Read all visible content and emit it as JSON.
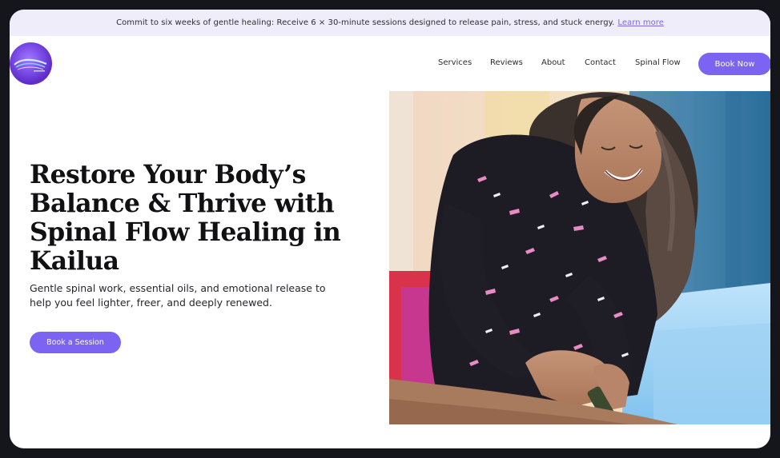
{
  "announcement": {
    "text": "Commit to six weeks of gentle healing: Receive 6 × 30-minute sessions designed to release pain, stress, and stuck energy.",
    "link_label": "Learn more"
  },
  "nav": {
    "items": [
      {
        "label": "Services"
      },
      {
        "label": "Reviews"
      },
      {
        "label": "About"
      },
      {
        "label": "Contact"
      },
      {
        "label": "Spinal Flow"
      }
    ],
    "cta_label": "Book Now"
  },
  "hero": {
    "title": "Restore Your Body’s Balance & Thrive with Spinal Flow Healing in Kailua",
    "subtitle": "Gentle spinal work, essential oils, and emotional release to help you feel lighter, freer, and deeply renewed.",
    "cta_label": "Book a Session"
  },
  "colors": {
    "accent": "#7c63f2",
    "announcement_bg": "#efedfa",
    "link": "#7a6ae8",
    "text": "#111114"
  }
}
